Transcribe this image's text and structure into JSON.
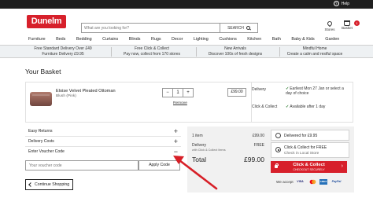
{
  "topbar": {
    "help_label": "Help",
    "help_icon": "question-icon"
  },
  "header": {
    "logo_text": "Dunelm",
    "search_placeholder": "What are you looking for?",
    "search_button": "SEARCH",
    "stores_label": "Stores",
    "basket_label": "Basket",
    "basket_count": "1"
  },
  "nav": [
    "Furniture",
    "Beds",
    "Bedding",
    "Curtains",
    "Blinds",
    "Rugs",
    "Decor",
    "Lighting",
    "Cushions",
    "Kitchen",
    "Bath",
    "Baby & Kids",
    "Garden"
  ],
  "promos": [
    {
      "line1": "Free Standard Delivery Over £49",
      "line2": "Furniture Delivery £9.95"
    },
    {
      "line1": "Free Click & Collect",
      "line2": "Pay now, collect from 170 stores"
    },
    {
      "line1": "New Arrivals",
      "line2": "Discover 100s of fresh designs"
    },
    {
      "line1": "Mindful Home",
      "line2": "Create a calm and restful space"
    }
  ],
  "page_title": "Your Basket",
  "item": {
    "name": "Eloise Velvet Pleated Ottoman",
    "variant": "Blush (Pink)",
    "quantity": "1",
    "minus": "−",
    "plus": "+",
    "remove": "Remove",
    "price": "£99.00",
    "delivery_label": "Delivery",
    "delivery_status": "Earliest Mon 27 Jan or select a day of choice",
    "cc_label": "Click & Collect",
    "cc_status": "Available after 1 day"
  },
  "accordion": [
    {
      "label": "Easy Returns",
      "sign": "+"
    },
    {
      "label": "Delivery Costs",
      "sign": "+"
    },
    {
      "label": "Enter Voucher Code",
      "sign": "−"
    }
  ],
  "voucher": {
    "placeholder": "Your voucher code",
    "apply": "Apply Code"
  },
  "continue_label": "Continue Shopping",
  "summary": {
    "items_label": "1 item",
    "items_value": "£99.00",
    "delivery_label": "Delivery",
    "delivery_value": "FREE",
    "delivery_sub": "with Click & Collect Items",
    "total_label": "Total",
    "total_value": "£99.00",
    "option1": "Delivered for £9.95",
    "option2_line1": "Click & Collect for FREE",
    "option2_line2": "Check in Local Store",
    "checkout_line1": "Click & Collect",
    "checkout_line2": "CHECKOUT SECURELY",
    "accept_label": "We accept",
    "cards": [
      "VISA",
      "MC",
      "AMEX",
      "PayPal"
    ]
  },
  "colors": {
    "brand_red": "#d7202b",
    "annotation_arrow": "#d71f27"
  }
}
